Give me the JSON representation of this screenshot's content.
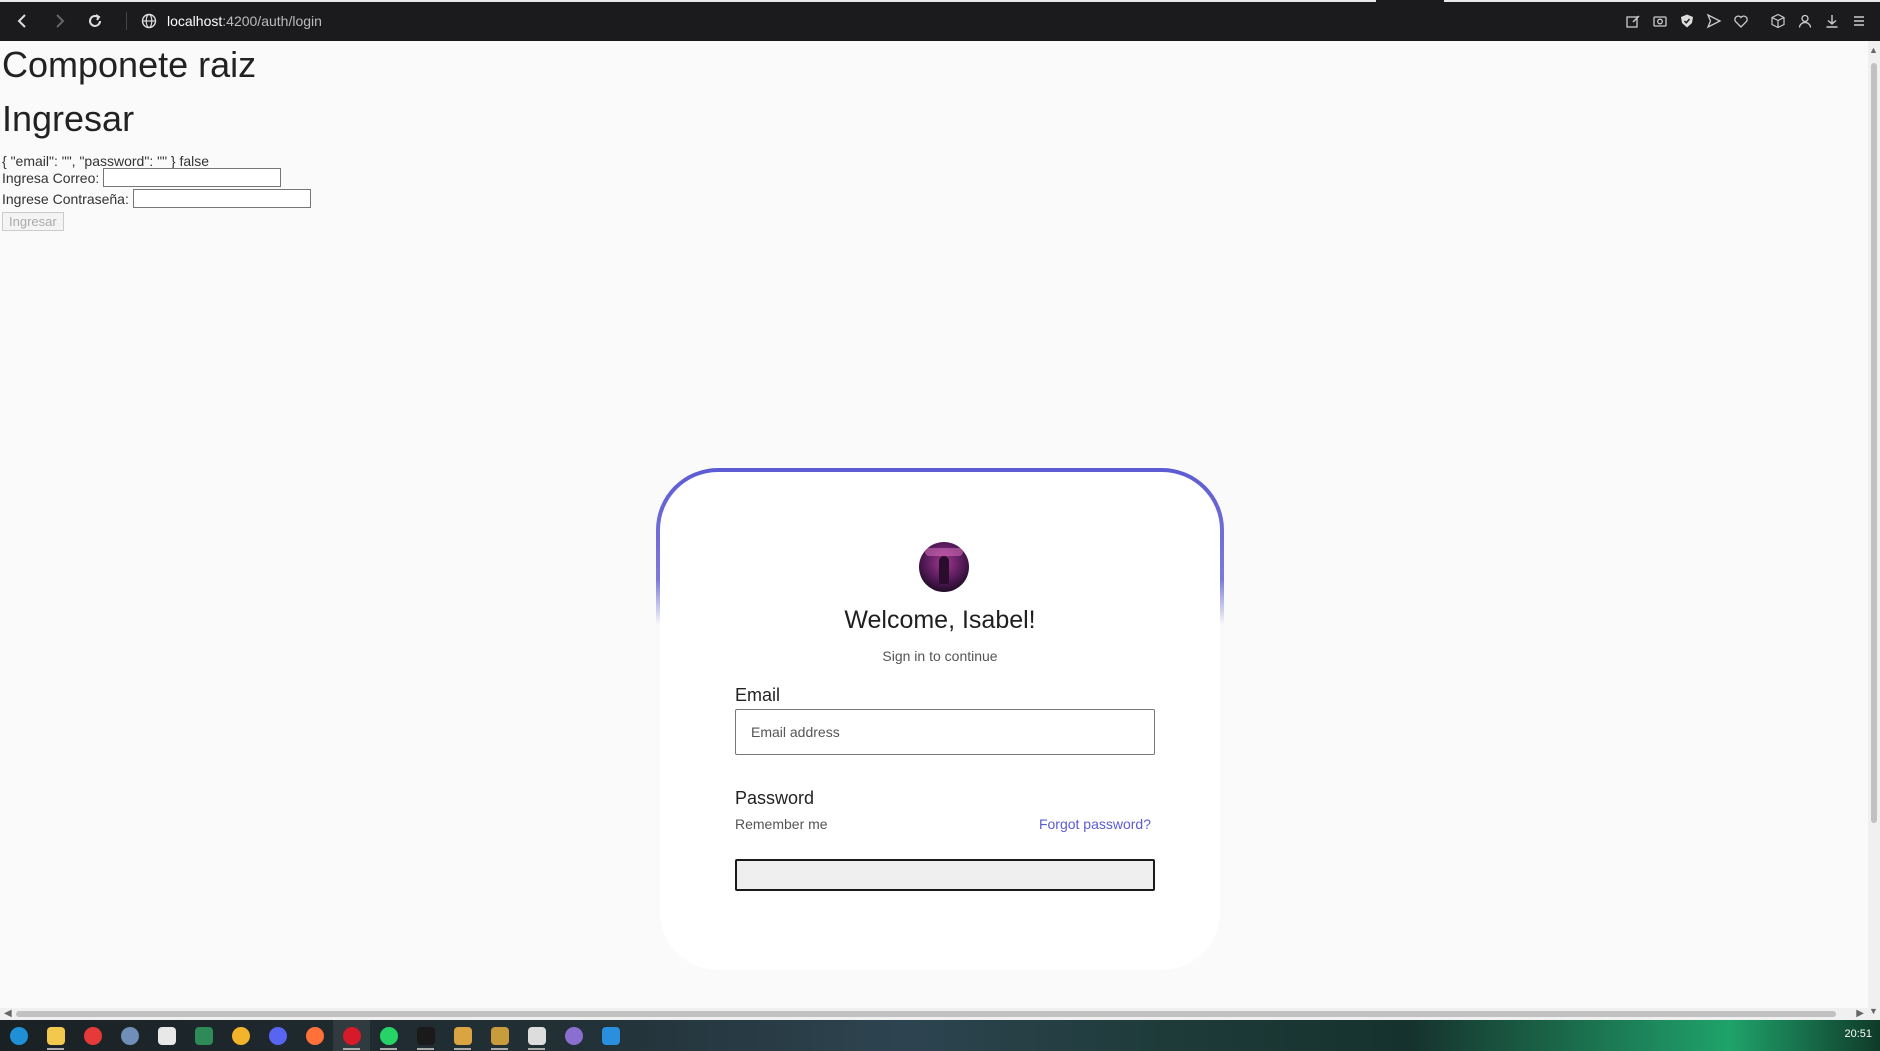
{
  "browser": {
    "url_host": "localhost",
    "url_path": ":4200/auth/login"
  },
  "page": {
    "root_title": "Componete raiz",
    "login_title": "Ingresar",
    "debug_text": "{ \"email\": \"\", \"password\": \"\" } false",
    "email_label": "Ingresa Correo:",
    "password_label": "Ingrese Contraseña:",
    "submit_label": "Ingresar"
  },
  "card": {
    "welcome": "Welcome, Isabel!",
    "subtitle": "Sign in to continue",
    "email_label": "Email",
    "email_placeholder": "Email address",
    "password_label": "Password",
    "remember_label": "Remember me",
    "forgot_label": "Forgot password?",
    "accent_color": "#5d5bd4",
    "link_color": "#5b5bd6"
  },
  "taskbar": {
    "clock": "20:51",
    "apps": [
      {
        "name": "edge-icon",
        "color": "#1f8fd6"
      },
      {
        "name": "file-explorer-icon",
        "color": "#f2c94c"
      },
      {
        "name": "red-app-icon",
        "color": "#e63a3a"
      },
      {
        "name": "web-app-icon",
        "color": "#6f8fb8"
      },
      {
        "name": "notepad-icon",
        "color": "#e8e8e8"
      },
      {
        "name": "green-app-icon",
        "color": "#2e8b57"
      },
      {
        "name": "chrome-icon",
        "color": "#f3b32b"
      },
      {
        "name": "discord-icon",
        "color": "#5865f2"
      },
      {
        "name": "firefox-icon",
        "color": "#ff7139"
      },
      {
        "name": "opera-icon",
        "color": "#d61a2a"
      },
      {
        "name": "whatsapp-icon",
        "color": "#25d366"
      },
      {
        "name": "intellij-icon",
        "color": "#1a1a1a"
      },
      {
        "name": "box-app-icon",
        "color": "#d9a441"
      },
      {
        "name": "league-icon",
        "color": "#c89b3c"
      },
      {
        "name": "controller-icon",
        "color": "#dddddd"
      },
      {
        "name": "github-icon",
        "color": "#8a6fd1"
      },
      {
        "name": "vscode-icon",
        "color": "#2a8fdc"
      }
    ]
  }
}
